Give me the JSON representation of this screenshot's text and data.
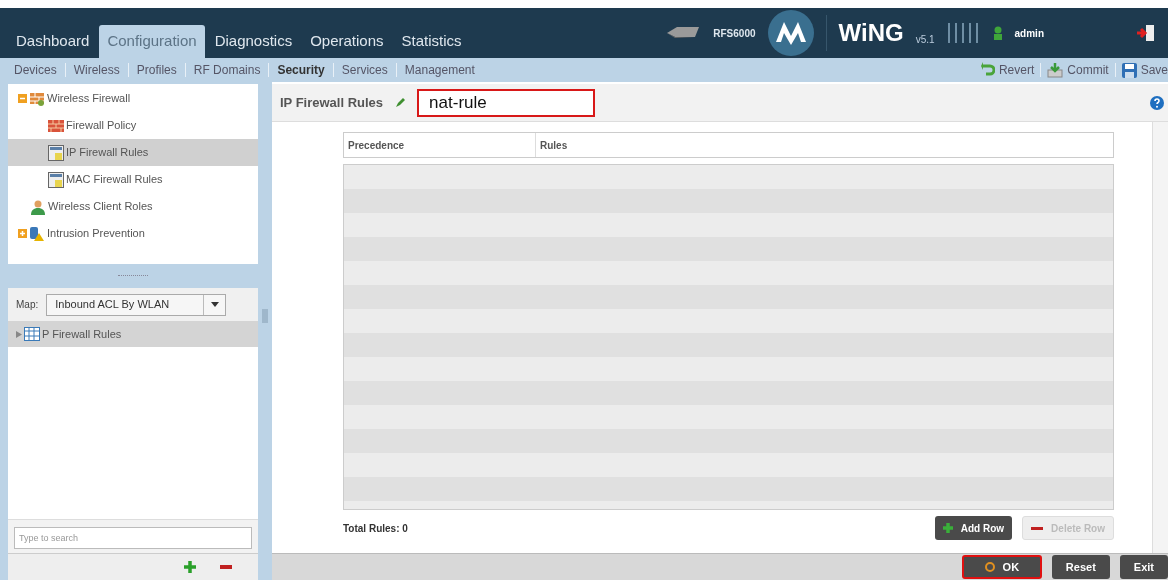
{
  "header": {
    "tabs": [
      {
        "label": "Dashboard",
        "selected": false
      },
      {
        "label": "Configuration",
        "selected": true
      },
      {
        "label": "Diagnostics",
        "selected": false
      },
      {
        "label": "Operations",
        "selected": false
      },
      {
        "label": "Statistics",
        "selected": false
      }
    ],
    "device": "RFS6000",
    "product": "WiNG",
    "version": "v5.1",
    "user": "admin"
  },
  "subnav": {
    "items": [
      {
        "label": "Devices",
        "selected": false
      },
      {
        "label": "Wireless",
        "selected": false
      },
      {
        "label": "Profiles",
        "selected": false
      },
      {
        "label": "RF Domains",
        "selected": false
      },
      {
        "label": "Security",
        "selected": true
      },
      {
        "label": "Services",
        "selected": false
      },
      {
        "label": "Management",
        "selected": false
      }
    ],
    "actions": [
      {
        "label": "Revert",
        "kind": "revert"
      },
      {
        "label": "Commit",
        "kind": "commit"
      },
      {
        "label": "Save",
        "kind": "save"
      }
    ]
  },
  "sidebar": {
    "tree": [
      {
        "label": "Wireless Firewall",
        "kind": "firewall",
        "expanded": true,
        "selected": false,
        "children": [
          {
            "label": "Firewall Policy",
            "kind": "policy",
            "selected": false
          },
          {
            "label": "IP Firewall Rules",
            "kind": "rules",
            "selected": true
          },
          {
            "label": "MAC Firewall Rules",
            "kind": "rules",
            "selected": false
          }
        ]
      },
      {
        "label": "Wireless Client Roles",
        "kind": "user",
        "selected": false
      },
      {
        "label": "Intrusion Prevention",
        "kind": "ips",
        "expanded": false,
        "selected": false
      }
    ],
    "map_label": "Map:",
    "map_value": "Inbound ACL By WLAN",
    "map_tree": [
      {
        "label": "P Firewall Rules",
        "expanded": false
      }
    ],
    "search": {
      "placeholder": "Type to search"
    }
  },
  "main": {
    "title": "IP Firewall Rules",
    "name_field": {
      "value": "nat-rule",
      "highlighted": true
    },
    "table": {
      "columns": [
        "Precedence",
        "Rules"
      ]
    },
    "total": "Total Rules: 0",
    "table_buttons": [
      {
        "label": "Add Row",
        "kind": "add",
        "disabled": false
      },
      {
        "label": "Delete Row",
        "kind": "delete",
        "disabled": true
      }
    ],
    "footer_buttons": [
      {
        "label": "OK",
        "kind": "ok",
        "highlighted": true
      },
      {
        "label": "Reset",
        "kind": "plain",
        "highlighted": false
      },
      {
        "label": "Exit",
        "kind": "plain",
        "highlighted": false
      }
    ]
  }
}
